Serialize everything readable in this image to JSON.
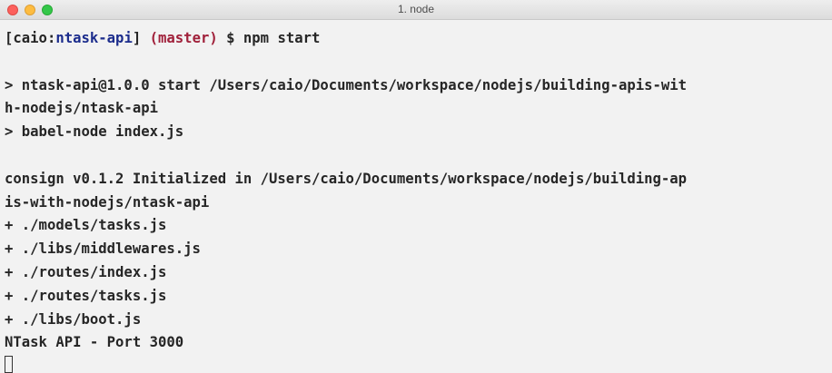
{
  "window": {
    "title": "1. node"
  },
  "prompt": {
    "open_bracket": "[",
    "user": "caio:",
    "directory": "ntask-api",
    "close_bracket": "]",
    "branch": "(master)",
    "symbol": "$",
    "command": "npm start"
  },
  "output": {
    "lines": [
      "",
      "> ntask-api@1.0.0 start /Users/caio/Documents/workspace/nodejs/building-apis-wit",
      "h-nodejs/ntask-api",
      "> babel-node index.js",
      "",
      "consign v0.1.2 Initialized in /Users/caio/Documents/workspace/nodejs/building-ap",
      "is-with-nodejs/ntask-api",
      "+ ./models/tasks.js",
      "+ ./libs/middlewares.js",
      "+ ./routes/index.js",
      "+ ./routes/tasks.js",
      "+ ./libs/boot.js",
      "NTask API - Port 3000"
    ]
  }
}
